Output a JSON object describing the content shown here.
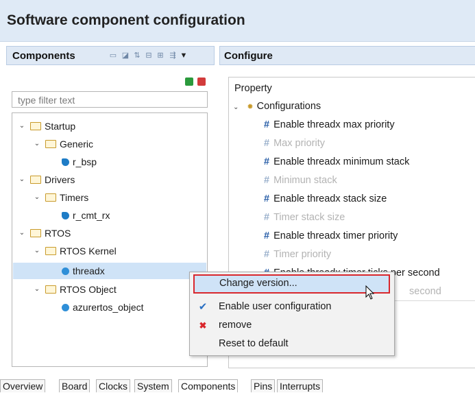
{
  "window": {
    "title": "Software component configuration"
  },
  "components_pane": {
    "title": "Components",
    "filter_placeholder": "type filter text",
    "tree": [
      {
        "label": "Startup",
        "kind": "folder",
        "level": 0
      },
      {
        "label": "Generic",
        "kind": "folder",
        "level": 1
      },
      {
        "label": "r_bsp",
        "kind": "component",
        "level": 2
      },
      {
        "label": "Drivers",
        "kind": "folder",
        "level": 0
      },
      {
        "label": "Timers",
        "kind": "folder",
        "level": 1
      },
      {
        "label": "r_cmt_rx",
        "kind": "component",
        "level": 2
      },
      {
        "label": "RTOS",
        "kind": "folder",
        "level": 0
      },
      {
        "label": "RTOS Kernel",
        "kind": "folder",
        "level": 1
      },
      {
        "label": "threadx",
        "kind": "component",
        "level": 2,
        "selected": true
      },
      {
        "label": "RTOS Object",
        "kind": "folder",
        "level": 1
      },
      {
        "label": "azurertos_object",
        "kind": "component",
        "level": 2
      }
    ]
  },
  "configure_pane": {
    "title": "Configure",
    "column_header": "Property",
    "group_label": "Configurations",
    "properties": [
      {
        "label": "Enable threadx max priority",
        "enabled": true
      },
      {
        "label": "Max priority",
        "enabled": false
      },
      {
        "label": "Enable threadx minimum stack",
        "enabled": true
      },
      {
        "label": "Minimun stack",
        "enabled": false
      },
      {
        "label": "Enable threadx stack size",
        "enabled": true
      },
      {
        "label": "Timer stack size",
        "enabled": false
      },
      {
        "label": "Enable threadx timer priority",
        "enabled": true
      },
      {
        "label": "Timer priority",
        "enabled": false
      },
      {
        "label": "Enable threadx timer ticks per second",
        "enabled": true
      },
      {
        "label": "second",
        "enabled": false
      }
    ]
  },
  "context_menu": {
    "items": [
      {
        "label": "Change version...",
        "icon": "none",
        "highlighted": true
      },
      {
        "label": "Enable user configuration",
        "icon": "check-icon"
      },
      {
        "label": "remove",
        "icon": "red-x-icon"
      },
      {
        "label": "Reset to default",
        "icon": "none"
      }
    ]
  },
  "bottom_tabs": [
    "Overview",
    "Board",
    "Clocks",
    "System",
    "Components",
    "Pins",
    "Interrupts"
  ],
  "active_bottom_tab": "Components",
  "colors": {
    "header_bg": "#dfeaf6",
    "selection": "#cfe3f7",
    "highlight_border": "#d9262c",
    "accent_blue": "#2a5fa8"
  }
}
